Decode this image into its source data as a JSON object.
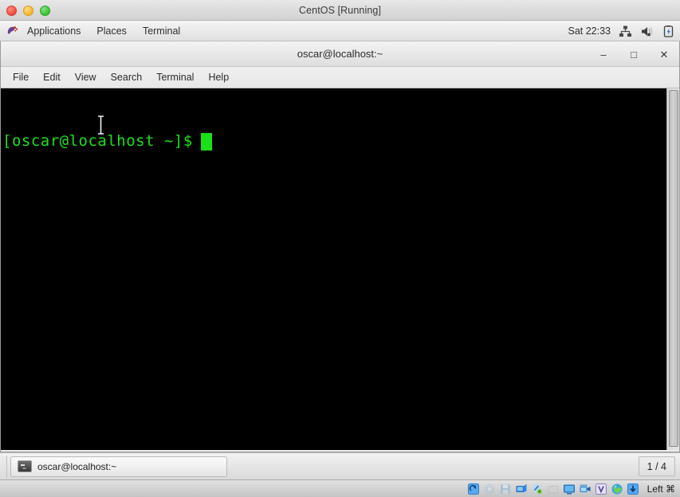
{
  "host_window": {
    "title": "CentOS [Running]",
    "traffic_lights": [
      {
        "name": "close",
        "color": "#f04a3f"
      },
      {
        "name": "minimize",
        "color": "#f5b429"
      },
      {
        "name": "zoom",
        "color": "#39c12f"
      }
    ]
  },
  "gnome_top_panel": {
    "foot_icon": "gnome-foot-icon",
    "menus": [
      {
        "label": "Applications",
        "icon": "gnome-foot-icon"
      },
      {
        "label": "Places",
        "icon": ""
      },
      {
        "label": "Terminal",
        "icon": ""
      }
    ],
    "clock": "Sat 22:33",
    "tray": [
      {
        "name": "network-icon",
        "title": "Network"
      },
      {
        "name": "volume-muted-icon",
        "title": "Volume muted"
      },
      {
        "name": "battery-icon",
        "title": "Battery"
      }
    ]
  },
  "terminal_window": {
    "title": "oscar@localhost:~",
    "controls": {
      "minimize": "‒",
      "maximize": "□",
      "close": "✕"
    },
    "menubar": [
      {
        "label": "File"
      },
      {
        "label": "Edit"
      },
      {
        "label": "View"
      },
      {
        "label": "Search"
      },
      {
        "label": "Terminal"
      },
      {
        "label": "Help"
      }
    ],
    "screen": {
      "prompt": "[oscar@localhost ~]$",
      "command": "",
      "cursor": "block",
      "foreground": "#19e019",
      "background": "#000000",
      "lines": [
        "[oscar@localhost ~]$ "
      ]
    },
    "scrollbar": {
      "name": "vertical-scrollbar",
      "position": "top"
    }
  },
  "gnome_bottom_panel": {
    "show_desktop": "show-desktop-button",
    "tasks": [
      {
        "label": "oscar@localhost:~",
        "icon": "terminal-icon",
        "active": true
      }
    ],
    "workspace_switcher": "1 / 4"
  },
  "vbox_status_bar": {
    "icons": [
      {
        "name": "hard-disk-icon",
        "dim": false
      },
      {
        "name": "optical-disk-icon",
        "dim": true
      },
      {
        "name": "floppy-disk-icon",
        "dim": true
      },
      {
        "name": "network-adapter-icon",
        "dim": false
      },
      {
        "name": "usb-icon",
        "dim": false
      },
      {
        "name": "shared-folders-icon",
        "dim": true
      },
      {
        "name": "display-icon",
        "dim": false
      },
      {
        "name": "video-capture-icon",
        "dim": false
      },
      {
        "name": "remote-desktop-icon",
        "dim": false
      },
      {
        "name": "mouse-integration-icon",
        "dim": false
      },
      {
        "name": "host-key-icon",
        "dim": false
      }
    ],
    "host_key": "Left ⌘"
  }
}
